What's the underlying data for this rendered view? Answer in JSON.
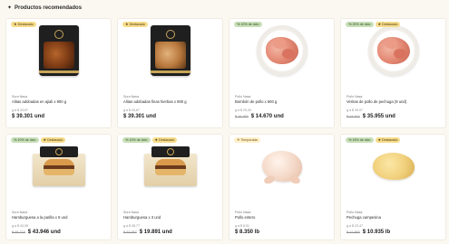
{
  "section": {
    "icon": "star-sparkle-icon",
    "title": "Productos recomendados"
  },
  "colors": {
    "destacado": "#f6dc8b",
    "discount": "#c8dfb8",
    "temporada": "#fff0c9"
  },
  "products": [
    {
      "badges": [
        {
          "type": "destacado",
          "icon": "star-icon",
          "label": "Destacado"
        }
      ],
      "image": "packaged-chicken-wings-bag",
      "brand": "Sura Nasa",
      "name": "Alitas adobadas en ajiali x 900 g",
      "unit_price": "g a $ 43,67",
      "old_price": "",
      "price": "$ 39.301 und"
    },
    {
      "badges": [
        {
          "type": "destacado",
          "icon": "star-icon",
          "label": "Destacado"
        }
      ],
      "image": "packaged-seasoned-wings-bag",
      "brand": "Sura Nasa",
      "name": "Alitas adobadas finas hierbas x 900 g",
      "unit_price": "g a $ 43,67",
      "old_price": "",
      "price": "$ 39.301 und"
    },
    {
      "badges": [
        {
          "type": "discount",
          "icon": "tag-icon",
          "label": "10% de dcto"
        }
      ],
      "image": "raw-chicken-pieces-plate",
      "brand": "Pollo Nasa",
      "name": "Bombón de pollo x 500 g",
      "unit_price": "g a $ 29,34",
      "old_price": "$ 16.300",
      "price": "$ 14.670 und"
    },
    {
      "badges": [
        {
          "type": "discount",
          "icon": "tag-icon",
          "label": "20% de dcto"
        },
        {
          "type": "destacado",
          "icon": "star-icon",
          "label": "Destacado"
        }
      ],
      "image": "chicken-breast-steaks-plate",
      "brand": "Pollo Nasa",
      "name": "Veritas de pollo de pechuga (9 und)",
      "unit_price": "g a $ 39,97",
      "old_price": "$ 44.944",
      "price": "$ 35.955 und"
    },
    {
      "badges": [
        {
          "type": "discount",
          "icon": "tag-icon",
          "label": "10% de dcto"
        },
        {
          "type": "destacado",
          "icon": "star-icon",
          "label": "Destacado"
        }
      ],
      "image": "burger-patties-box",
      "brand": "Sura Nasa",
      "name": "Hamburguesa a la parilla x 6 und",
      "unit_price": "g a $ 43,95",
      "old_price": "$ 48.718",
      "price": "$ 43.946 und"
    },
    {
      "badges": [
        {
          "type": "discount",
          "icon": "tag-icon",
          "label": "10% de dcto"
        },
        {
          "type": "destacado",
          "icon": "star-icon",
          "label": "Destacado"
        }
      ],
      "image": "burger-patties-box",
      "brand": "Sura Nasa",
      "name": "Hamburguesa x 3 und",
      "unit_price": "g a $ 45,77",
      "old_price": "$ 22.067",
      "price": "$ 19.891 und"
    },
    {
      "badges": [
        {
          "type": "temporada",
          "icon": "sun-icon",
          "label": "Temporada"
        }
      ],
      "image": "whole-raw-chicken",
      "brand": "Pollo Nasa",
      "name": "Pollo entero",
      "unit_price": "g a $ 8,51",
      "old_price": "",
      "price": "$ 8.350 lb"
    },
    {
      "badges": [
        {
          "type": "discount",
          "icon": "tag-icon",
          "label": "15% de dcto"
        },
        {
          "type": "destacado",
          "icon": "star-icon",
          "label": "Destacado"
        }
      ],
      "image": "chicken-breast-yellow",
      "brand": "Pollo Nasa",
      "name": "Pechuga campesina",
      "unit_price": "g a $ 23,47",
      "old_price": "$ 12.865",
      "price": "$ 10.935 lb"
    }
  ]
}
